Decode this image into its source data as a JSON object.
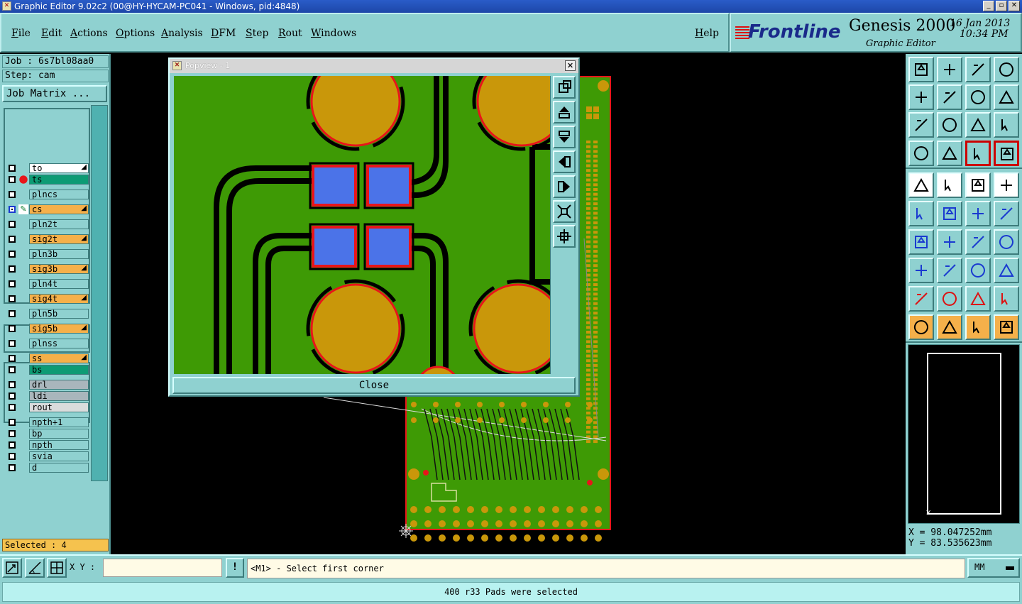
{
  "window": {
    "title": "Graphic Editor 9.02c2 (00@HY-HYCAM-PC041 - Windows, pid:4848)",
    "controls": [
      "_",
      "▫",
      "✕"
    ]
  },
  "menu": {
    "items": [
      "File",
      "Edit",
      "Actions",
      "Options",
      "Analysis",
      "DFM",
      "Step",
      "Rout",
      "Windows"
    ],
    "help": "Help"
  },
  "brand": {
    "logo": "Frontline",
    "product": "Genesis 2000",
    "subtitle": "Graphic Editor",
    "date": "16 Jan 2013",
    "time": "10:34 PM"
  },
  "job": {
    "job_label": "Job : 6s7bl08aa0",
    "step_label": "Step: cam",
    "matrix_button": "Job Matrix ..."
  },
  "layers": [
    {
      "name": "to",
      "bg": "#ffffff",
      "indicator": "",
      "arrow": true
    },
    {
      "name": "ts",
      "bg": "#0d9b74",
      "indicator": "red",
      "arrow": false
    },
    {
      "name": "plncs",
      "bg": "#8fd1d0",
      "indicator": "",
      "arrow": false
    },
    {
      "name": "cs",
      "bg": "#f5b04a",
      "indicator": "work",
      "arrow": true,
      "active": true
    },
    {
      "name": "pln2t",
      "bg": "#8fd1d0",
      "indicator": "",
      "arrow": false
    },
    {
      "name": "sig2t",
      "bg": "#f5b04a",
      "indicator": "",
      "arrow": true
    },
    {
      "name": "pln3b",
      "bg": "#8fd1d0",
      "indicator": "",
      "arrow": false
    },
    {
      "name": "sig3b",
      "bg": "#f5b04a",
      "indicator": "",
      "arrow": true
    },
    {
      "name": "pln4t",
      "bg": "#8fd1d0",
      "indicator": "",
      "arrow": false
    },
    {
      "name": "sig4t",
      "bg": "#f5b04a",
      "indicator": "",
      "arrow": true
    },
    {
      "name": "pln5b",
      "bg": "#8fd1d0",
      "indicator": "",
      "arrow": false
    },
    {
      "name": "sig5b",
      "bg": "#f5b04a",
      "indicator": "",
      "arrow": true
    },
    {
      "name": "plnss",
      "bg": "#8fd1d0",
      "indicator": "",
      "arrow": false
    },
    {
      "name": "ss",
      "bg": "#f5b04a",
      "indicator": "",
      "arrow": true
    },
    {
      "name": "bs",
      "bg": "#0d9b74",
      "indicator": "",
      "arrow": false
    },
    {
      "name": "drl",
      "bg": "#a9b6bc",
      "indicator": "",
      "arrow": false
    },
    {
      "name": "ldi",
      "bg": "#a9b6bc",
      "indicator": "",
      "arrow": false
    },
    {
      "name": "rout",
      "bg": "#d9dcdc",
      "indicator": "",
      "arrow": false
    },
    {
      "name": "npth+1",
      "bg": "#8fd1d0",
      "indicator": "",
      "arrow": false
    },
    {
      "name": "bp",
      "bg": "#8fd1d0",
      "indicator": "",
      "arrow": false
    },
    {
      "name": "npth",
      "bg": "#8fd1d0",
      "indicator": "",
      "arrow": false
    },
    {
      "name": "svia",
      "bg": "#8fd1d0",
      "indicator": "",
      "arrow": false
    },
    {
      "name": "d",
      "bg": "#8fd1d0",
      "indicator": "",
      "arrow": false
    }
  ],
  "selected": "Selected : 4",
  "popview": {
    "title": "Popview - 1",
    "close_button": "Close"
  },
  "coords": {
    "x": "X = 98.047252mm",
    "y": "Y = 83.535623mm"
  },
  "input": {
    "xy_label": "X Y :",
    "xy_value": "",
    "bang_button": "!",
    "prompt": "<M1> - Select first corner",
    "units": "MM"
  },
  "status": "400 r33 Pads were selected",
  "colors": {
    "panel": "#8fd1d0",
    "board_green": "#3e9a05",
    "pad_gold": "#c9970a",
    "pad_outline": "#e8151a",
    "smd_blue": "#4b73e8"
  }
}
